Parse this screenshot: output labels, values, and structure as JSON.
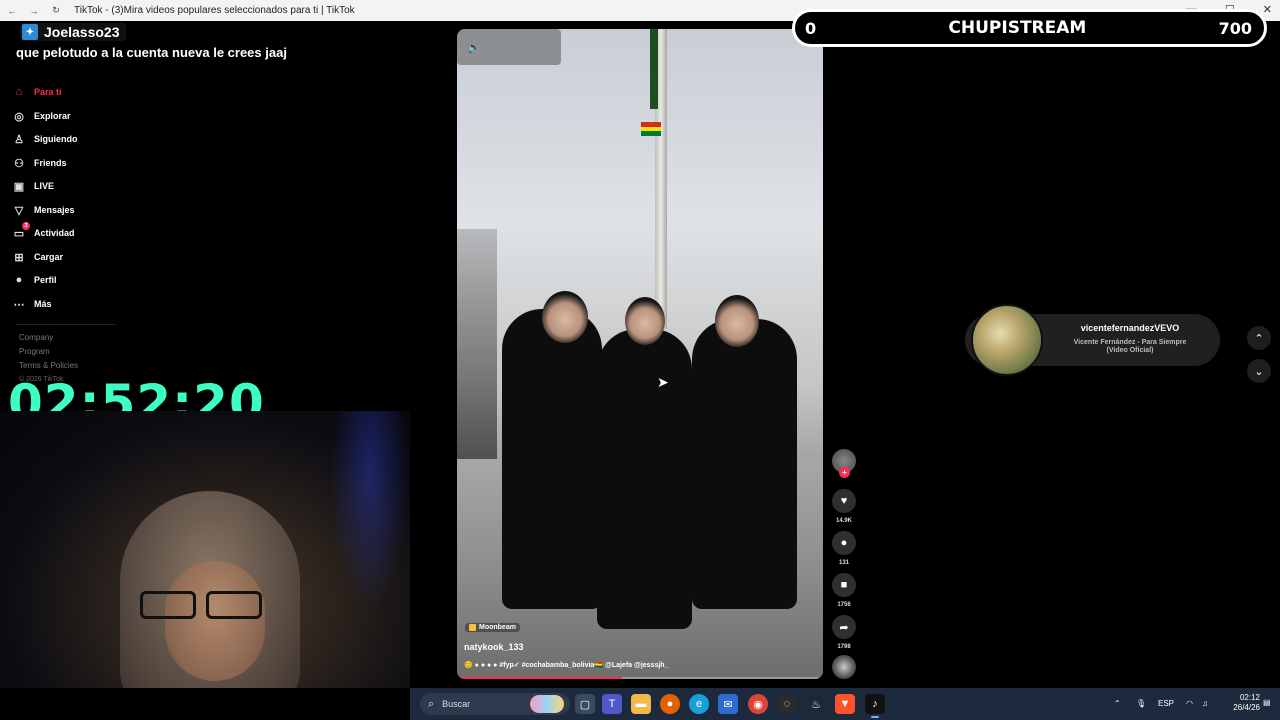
{
  "browser": {
    "title": "TikTok - (3)Mira videos populares seleccionados para ti | TikTok"
  },
  "sidebar": {
    "items": [
      {
        "label": "Para ti",
        "icon": "home-icon"
      },
      {
        "label": "Explorar",
        "icon": "compass-icon"
      },
      {
        "label": "Siguiendo",
        "icon": "following-icon"
      },
      {
        "label": "Friends",
        "icon": "friends-icon"
      },
      {
        "label": "LIVE",
        "icon": "live-icon"
      },
      {
        "label": "Mensajes",
        "icon": "messages-icon"
      },
      {
        "label": "Actividad",
        "icon": "activity-icon",
        "badge": "3"
      },
      {
        "label": "Cargar",
        "icon": "upload-icon"
      },
      {
        "label": "Perfil",
        "icon": "profile-icon"
      },
      {
        "label": "Más",
        "icon": "more-icon"
      }
    ],
    "footer": [
      "Company",
      "Program",
      "Terms & Policies"
    ],
    "copyright": "© 2026 TikTok"
  },
  "overlay": {
    "chat_user": "Joelasso23",
    "chat_message": "que pelotudo a la cuenta nueva le crees jaaj",
    "timer": "02:52:20",
    "banner_left": "0",
    "banner_title": "CHUPISTREAM",
    "banner_right": "700"
  },
  "video": {
    "music_tag": "Moonbeam",
    "username": "natykook_133",
    "desc_prefix": "😊 ● ● ● ●",
    "desc_tags": "#fyp✓ #cochabamba_bolivia🇧🇴 @Lajefa @jesssjh_",
    "progress": 0.45,
    "likes": "14.9K",
    "comments": "131",
    "saves": "1756",
    "shares": "1798"
  },
  "music_card": {
    "artist": "vicentefernandezVEVO",
    "song": "Vicente Fernández - Para Siempre (Video Oficial)"
  },
  "taskbar": {
    "search_placeholder": "Buscar",
    "lang": "ESP",
    "time": "02:12",
    "date": "26/4/26"
  }
}
